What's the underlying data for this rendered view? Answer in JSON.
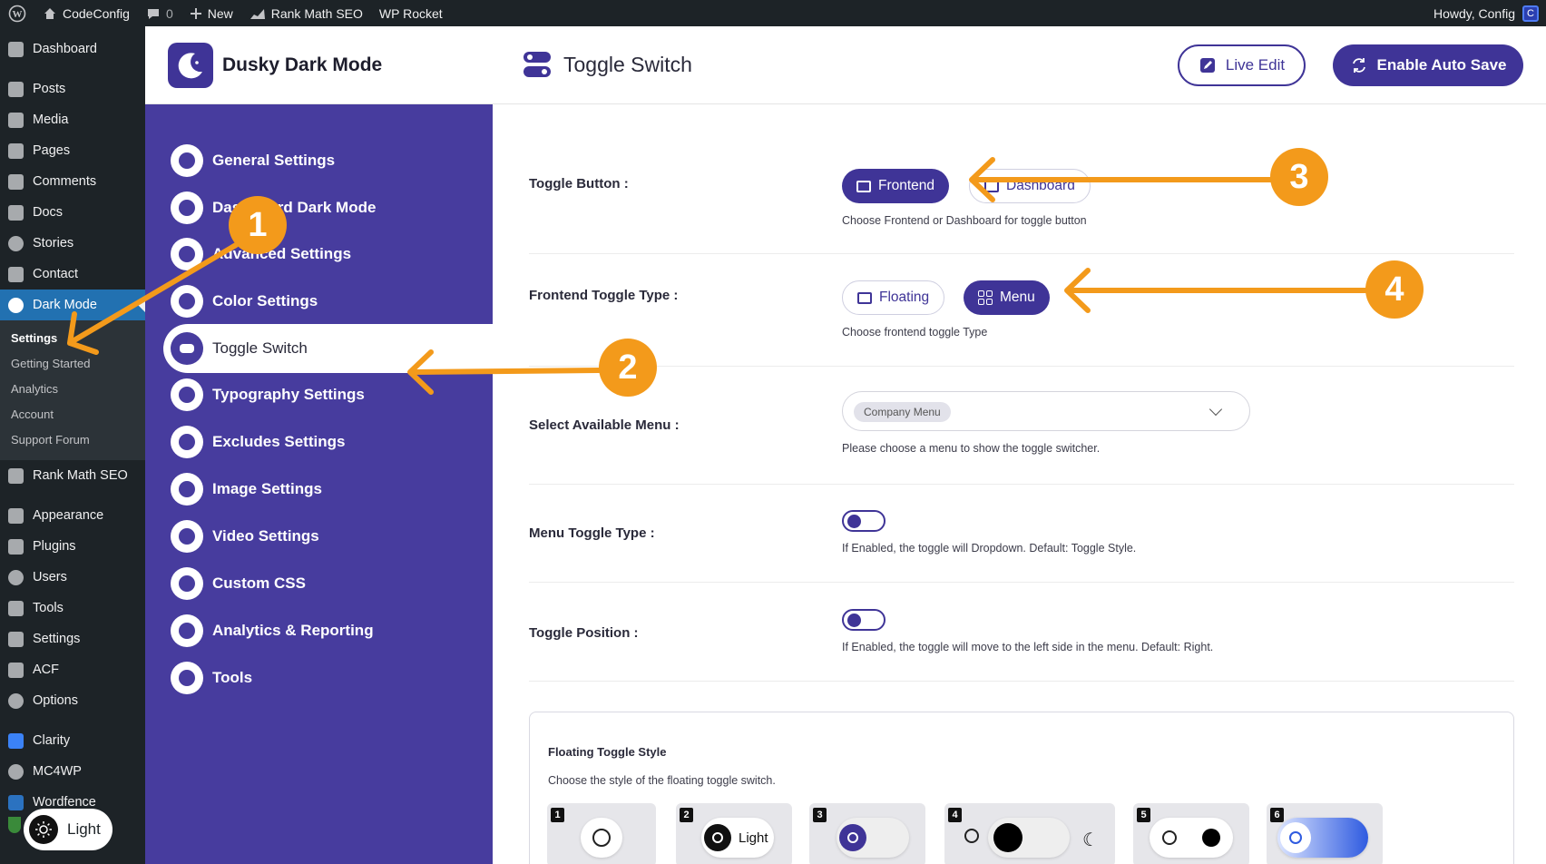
{
  "admin_bar": {
    "site_name": "CodeConfig",
    "comments_count": "0",
    "new_label": "New",
    "rank_math": "Rank Math SEO",
    "wp_rocket": "WP Rocket",
    "greeting": "Howdy, Config"
  },
  "wp_menu": {
    "items_top": [
      "Dashboard"
    ],
    "items_mid": [
      "Posts",
      "Media",
      "Pages",
      "Comments",
      "Docs",
      "Stories",
      "Contact"
    ],
    "active": "Dark Mode",
    "submenu": [
      "Settings",
      "Getting Started",
      "Analytics",
      "Account",
      "Support Forum"
    ],
    "items_after": [
      "Rank Math SEO"
    ],
    "items_lower": [
      "Appearance",
      "Plugins",
      "Users",
      "Tools",
      "Settings",
      "ACF",
      "Options"
    ],
    "items_bottom": [
      "Clarity",
      "MC4WP",
      "Wordfence"
    ],
    "light_label": "Light"
  },
  "plugin": {
    "name": "Dusky Dark Mode",
    "nav": [
      "General Settings",
      "Dashboard Dark Mode",
      "Advanced Settings",
      "Color Settings",
      "Toggle Switch",
      "Typography Settings",
      "Excludes Settings",
      "Image Settings",
      "Video Settings",
      "Custom CSS",
      "Analytics & Reporting",
      "Tools"
    ],
    "active_nav": "Toggle Switch"
  },
  "topbar": {
    "title": "Toggle Switch",
    "live_edit": "Live Edit",
    "auto_save": "Enable Auto Save"
  },
  "settings": {
    "toggle_button": {
      "label": "Toggle Button :",
      "options": [
        "Frontend",
        "Dashboard"
      ],
      "selected": "Frontend",
      "help": "Choose Frontend or Dashboard for toggle button"
    },
    "frontend_toggle_type": {
      "label": "Frontend Toggle Type :",
      "options": [
        "Floating",
        "Menu"
      ],
      "selected": "Menu",
      "help": "Choose frontend toggle Type"
    },
    "select_menu": {
      "label": "Select Available Menu :",
      "value": "Company Menu",
      "help": "Please choose a menu to show the toggle switcher."
    },
    "menu_toggle_type": {
      "label": "Menu Toggle Type :",
      "enabled": false,
      "help": "If Enabled, the toggle will Dropdown. Default: Toggle Style."
    },
    "toggle_position": {
      "label": "Toggle Position :",
      "enabled": false,
      "help": "If Enabled, the toggle will move to the left side in the menu. Default: Right."
    },
    "floating_style": {
      "title": "Floating Toggle Style",
      "subtitle": "Choose the style of the floating toggle switch.",
      "styles": [
        "1",
        "2",
        "3",
        "4",
        "5",
        "6"
      ],
      "style2_label": "Light"
    }
  },
  "annotations": [
    "1",
    "2",
    "3",
    "4"
  ],
  "colors": {
    "primary": "#3f3497",
    "nav_bg": "#473c9e",
    "wp_dark": "#1d2327",
    "wp_active": "#2271b1",
    "annotation": "#f39a1b"
  }
}
